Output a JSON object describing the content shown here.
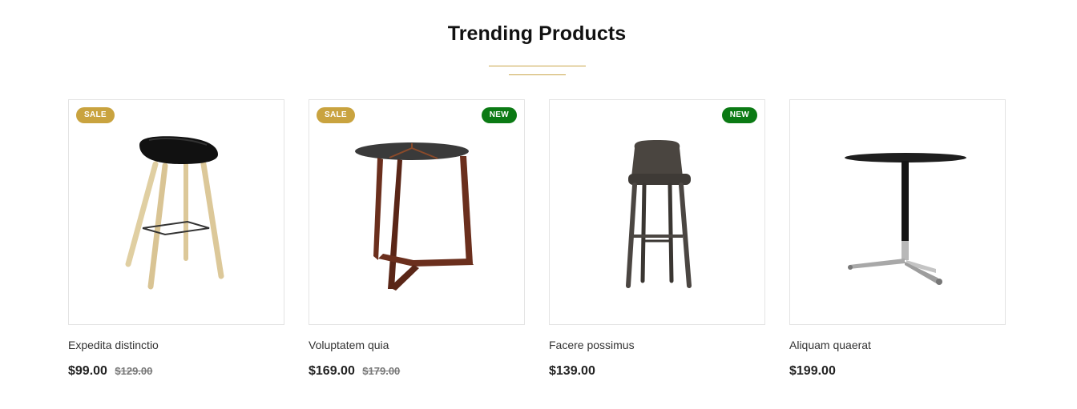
{
  "section": {
    "title": "Trending Products",
    "accent_color": "#c9a64a"
  },
  "products": [
    {
      "name": "Expedita distinctio",
      "price": "$99.00",
      "old_price": "$129.00",
      "badges": [
        "SALE"
      ],
      "image": "bar-stool-black-seat-wood-legs"
    },
    {
      "name": "Voluptatem quia",
      "price": "$169.00",
      "old_price": "$179.00",
      "badges": [
        "SALE",
        "NEW"
      ],
      "image": "walnut-side-table"
    },
    {
      "name": "Facere possimus",
      "price": "$139.00",
      "old_price": "",
      "badges": [
        "NEW"
      ],
      "image": "leather-counter-stool"
    },
    {
      "name": "Aliquam quaerat",
      "price": "$199.00",
      "old_price": "",
      "badges": [],
      "image": "round-bistro-table-chrome-base"
    }
  ],
  "badge_colors": {
    "sale": "#c9a33f",
    "new": "#0b7a14"
  },
  "badges": {
    "sale": "SALE",
    "new": "NEW"
  }
}
